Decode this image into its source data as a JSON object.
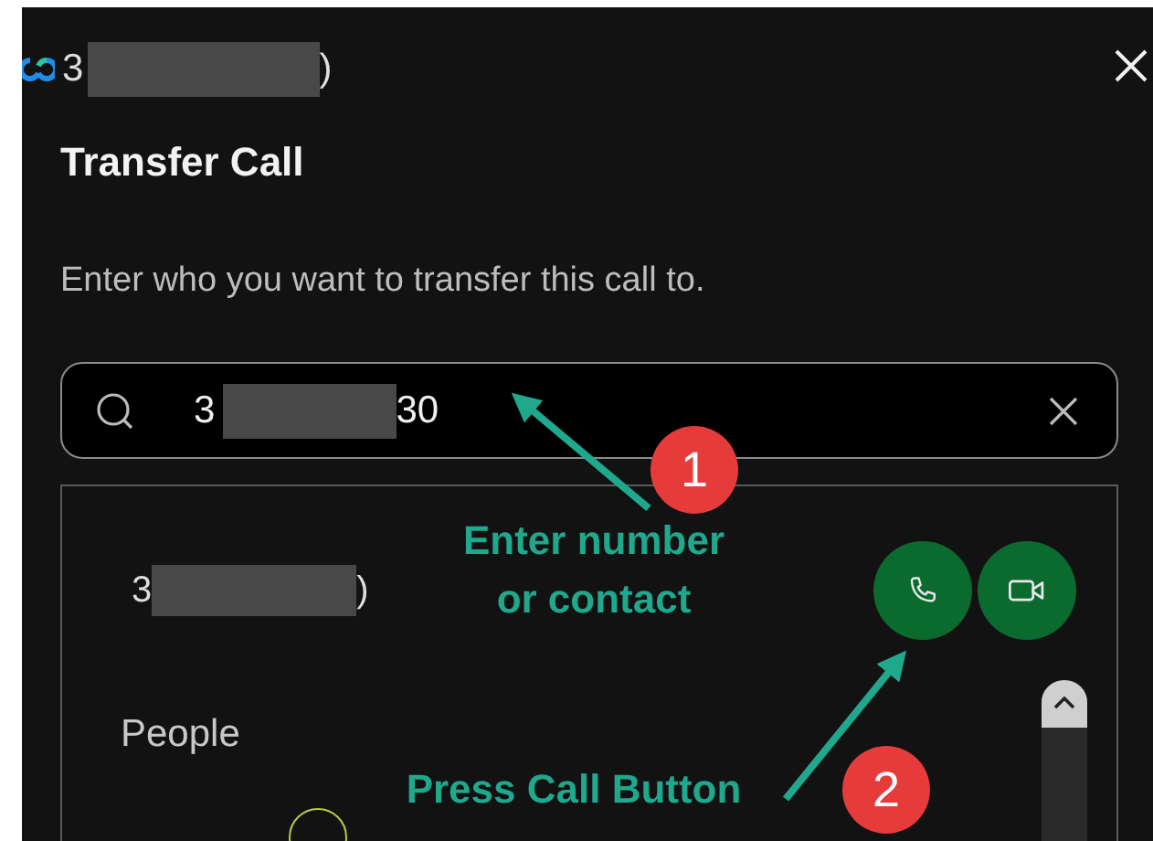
{
  "header": {
    "title_start": "3",
    "title_end": ")"
  },
  "dialog": {
    "title": "Transfer Call",
    "instruction": "Enter who you want to transfer this call to."
  },
  "search": {
    "value_start": "3",
    "value_end": "30"
  },
  "results": {
    "contact": {
      "name_start": "3",
      "name_end": ")"
    },
    "section": "People"
  },
  "call_buttons": [
    {
      "kind": "audio"
    },
    {
      "kind": "video"
    }
  ],
  "annotations": [
    {
      "badge": "1",
      "text": "Enter number\nor contact"
    },
    {
      "badge": "2",
      "text": "Press Call Button"
    }
  ]
}
